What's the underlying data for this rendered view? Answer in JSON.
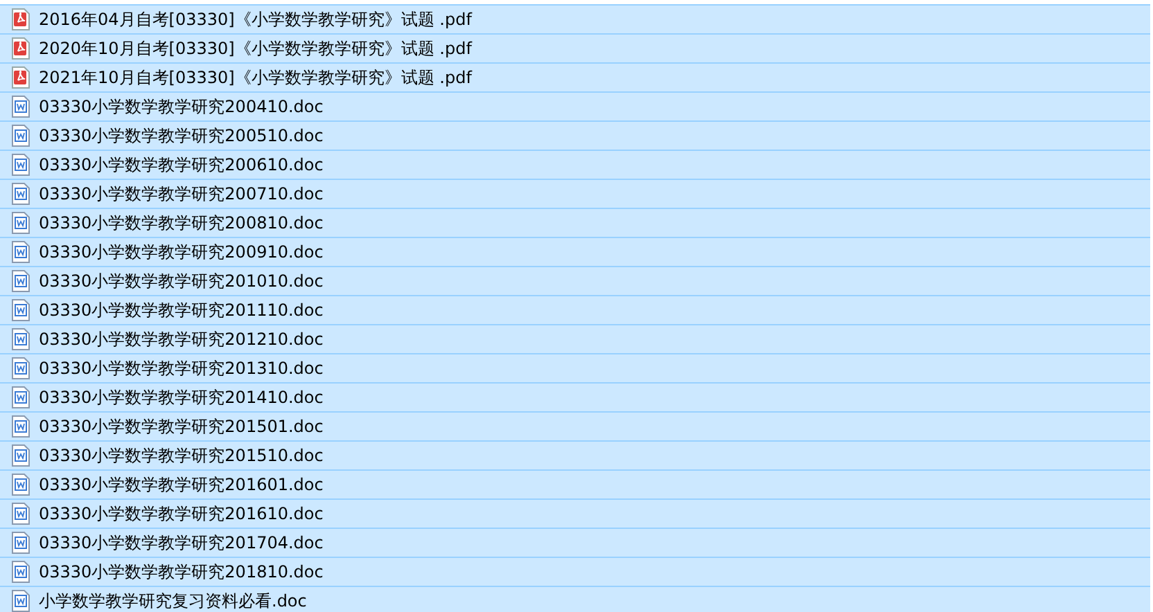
{
  "files": [
    {
      "name": "2016年04月自考[03330]《小学数学教学研究》试题 .pdf",
      "kind": "pdf",
      "selected": true
    },
    {
      "name": "2020年10月自考[03330]《小学数学教学研究》试题 .pdf",
      "kind": "pdf",
      "selected": true
    },
    {
      "name": "2021年10月自考[03330]《小学数学教学研究》试题 .pdf",
      "kind": "pdf",
      "selected": true
    },
    {
      "name": "03330小学数学教学研究200410.doc",
      "kind": "doc",
      "selected": true
    },
    {
      "name": "03330小学数学教学研究200510.doc",
      "kind": "doc",
      "selected": true
    },
    {
      "name": "03330小学数学教学研究200610.doc",
      "kind": "doc",
      "selected": true
    },
    {
      "name": "03330小学数学教学研究200710.doc",
      "kind": "doc",
      "selected": true
    },
    {
      "name": "03330小学数学教学研究200810.doc",
      "kind": "doc",
      "selected": true
    },
    {
      "name": "03330小学数学教学研究200910.doc",
      "kind": "doc",
      "selected": true
    },
    {
      "name": "03330小学数学教学研究201010.doc",
      "kind": "doc",
      "selected": true
    },
    {
      "name": "03330小学数学教学研究201110.doc",
      "kind": "doc",
      "selected": true
    },
    {
      "name": "03330小学数学教学研究201210.doc",
      "kind": "doc",
      "selected": true
    },
    {
      "name": "03330小学数学教学研究201310.doc",
      "kind": "doc",
      "selected": true
    },
    {
      "name": "03330小学数学教学研究201410.doc",
      "kind": "doc",
      "selected": true
    },
    {
      "name": "03330小学数学教学研究201501.doc",
      "kind": "doc",
      "selected": true
    },
    {
      "name": "03330小学数学教学研究201510.doc",
      "kind": "doc",
      "selected": true
    },
    {
      "name": "03330小学数学教学研究201601.doc",
      "kind": "doc",
      "selected": true
    },
    {
      "name": "03330小学数学教学研究201610.doc",
      "kind": "doc",
      "selected": true
    },
    {
      "name": "03330小学数学教学研究201704.doc",
      "kind": "doc",
      "selected": true
    },
    {
      "name": "03330小学数学教学研究201810.doc",
      "kind": "doc",
      "selected": true
    },
    {
      "name": "小学数学教学研究复习资料必看.doc",
      "kind": "doc",
      "selected": true
    }
  ]
}
